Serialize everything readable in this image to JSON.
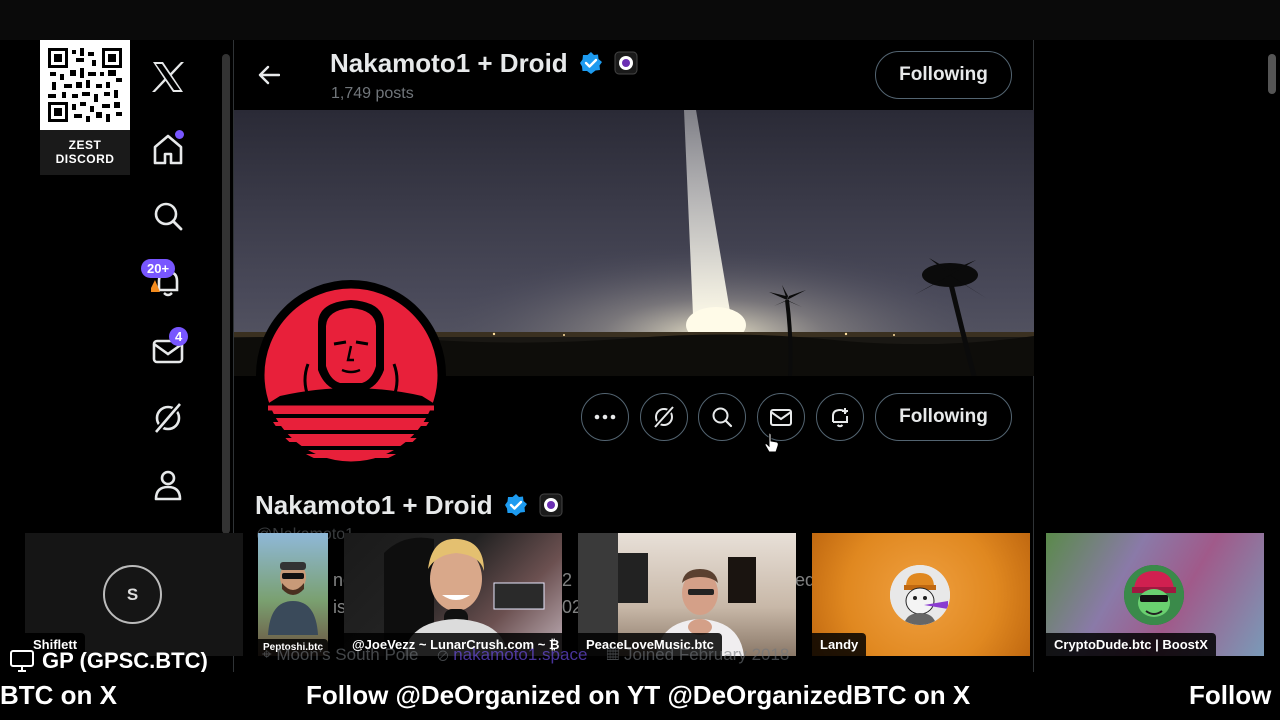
{
  "qr_badge": {
    "line1": "ZEST",
    "line2": "DISCORD"
  },
  "nav": {
    "notifications_badge": "20+",
    "messages_badge": "4"
  },
  "header": {
    "name": "Nakamoto1 + Droid",
    "posts": "1,749 posts",
    "follow_label": "Following"
  },
  "profile": {
    "name": "Nakamoto1 + Droid",
    "handle": "@Nakamoto1",
    "follow_label": "Following",
    "location": "Moon's South Pole",
    "website": "nakamoto1.space",
    "joined": "Joined February 2018"
  },
  "participants": [
    {
      "name": "Shiflett",
      "initial": "S"
    },
    {
      "name": "Peptoshi.btc"
    },
    {
      "name": "@JoeVezz ~ LunarCrush.com ~ ₿"
    },
    {
      "name": "PeaceLoveMusic.btc"
    },
    {
      "name": "Landy"
    },
    {
      "name": "CryptoDude.btc | BoostX"
    }
  ],
  "lower_third": {
    "label": "GP (GPSC.BTC)"
  },
  "ticker": {
    "left": "BTC on X",
    "center": "Follow @DeOrganized on YT @DeOrganizedBTC on X",
    "right": "Follow"
  },
  "colors": {
    "accent": "#7856ff",
    "verified": "#1d9bf0",
    "avatar_red": "#e8203a"
  }
}
